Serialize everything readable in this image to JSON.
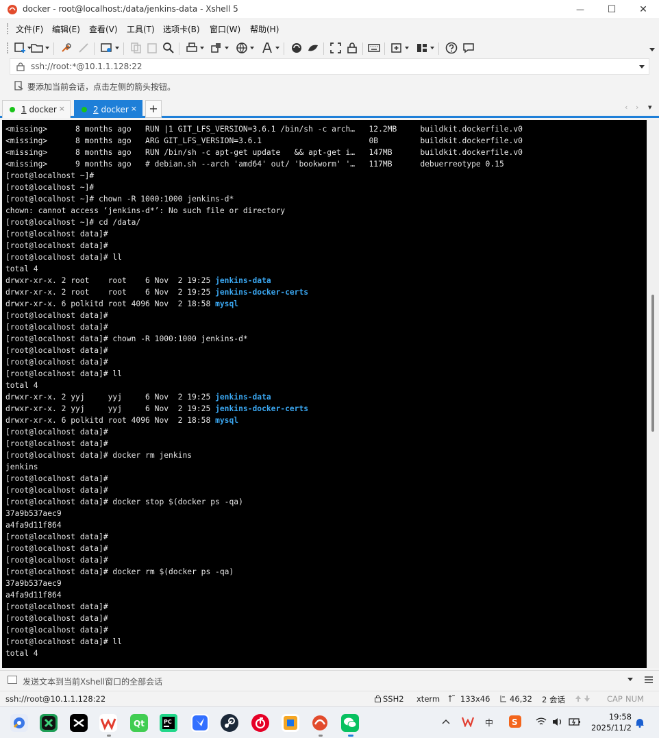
{
  "window": {
    "title": "docker - root@localhost:/data/jenkins-data - Xshell 5",
    "app_icon": "xshell-logo-icon",
    "controls": {
      "minimize": "—",
      "maximize": "☐",
      "close": "✕"
    }
  },
  "menu": {
    "items": [
      "文件(F)",
      "编辑(E)",
      "查看(V)",
      "工具(T)",
      "选项卡(B)",
      "窗口(W)",
      "帮助(H)"
    ]
  },
  "toolbar": {
    "icons": [
      "new-session-icon",
      "open-folder-icon",
      "reconnect-icon",
      "disconnect-icon",
      "properties-icon",
      "copy-icon",
      "paste-icon",
      "find-icon",
      "print-icon",
      "transfer-icon",
      "globe-icon",
      "font-icon",
      "xftp-icon",
      "xmanager-icon",
      "fullscreen-icon",
      "lock-icon",
      "keyboard-icon",
      "add-tab-icon",
      "layout-icon",
      "help-icon",
      "chat-icon"
    ]
  },
  "address": {
    "value": "ssh://root:*@10.1.1.128:22"
  },
  "hint": {
    "text": "要添加当前会话，点击左侧的箭头按钮。"
  },
  "tabs": [
    {
      "index": "1",
      "name": " docker",
      "close": "×",
      "active": false
    },
    {
      "index": "2",
      "name": " docker",
      "close": "×",
      "active": true
    }
  ],
  "tab_add": "+",
  "tab_nav": {
    "prev": "‹",
    "next": "›",
    "menu": "▾"
  },
  "terminal": {
    "lines": [
      {
        "text": "<missing>      8 months ago   RUN |1 GIT_LFS_VERSION=3.6.1 /bin/sh -c arch…   12.2MB     buildkit.dockerfile.v0"
      },
      {
        "text": "<missing>      8 months ago   ARG GIT_LFS_VERSION=3.6.1                       0B         buildkit.dockerfile.v0"
      },
      {
        "text": "<missing>      8 months ago   RUN /bin/sh -c apt-get update   && apt-get i…   147MB      buildkit.dockerfile.v0"
      },
      {
        "text": "<missing>      9 months ago   # debian.sh --arch 'amd64' out/ 'bookworm' '…   117MB      debuerreotype 0.15"
      },
      {
        "text": "[root@localhost ~]#"
      },
      {
        "text": "[root@localhost ~]#"
      },
      {
        "text": "[root@localhost ~]# chown -R 1000:1000 jenkins-d*"
      },
      {
        "text": "chown: cannot access ‘jenkins-d*’: No such file or directory"
      },
      {
        "text": "[root@localhost ~]# cd /data/"
      },
      {
        "text": "[root@localhost data]#"
      },
      {
        "text": "[root@localhost data]#"
      },
      {
        "text": "[root@localhost data]# ll"
      },
      {
        "text": "total 4"
      },
      {
        "text": "drwxr-xr-x. 2 root    root    6 Nov  2 19:25 ",
        "highlight": "jenkins-data"
      },
      {
        "text": "drwxr-xr-x. 2 root    root    6 Nov  2 19:25 ",
        "highlight": "jenkins-docker-certs"
      },
      {
        "text": "drwxr-xr-x. 6 polkitd root 4096 Nov  2 18:58 ",
        "highlight": "mysql"
      },
      {
        "text": "[root@localhost data]#"
      },
      {
        "text": "[root@localhost data]#"
      },
      {
        "text": "[root@localhost data]# chown -R 1000:1000 jenkins-d*"
      },
      {
        "text": "[root@localhost data]#"
      },
      {
        "text": "[root@localhost data]#"
      },
      {
        "text": "[root@localhost data]# ll"
      },
      {
        "text": "total 4"
      },
      {
        "text": "drwxr-xr-x. 2 yyj     yyj     6 Nov  2 19:25 ",
        "highlight": "jenkins-data"
      },
      {
        "text": "drwxr-xr-x. 2 yyj     yyj     6 Nov  2 19:25 ",
        "highlight": "jenkins-docker-certs"
      },
      {
        "text": "drwxr-xr-x. 6 polkitd root 4096 Nov  2 18:58 ",
        "highlight": "mysql"
      },
      {
        "text": "[root@localhost data]#"
      },
      {
        "text": "[root@localhost data]#"
      },
      {
        "text": "[root@localhost data]# docker rm jenkins"
      },
      {
        "text": "jenkins"
      },
      {
        "text": "[root@localhost data]#"
      },
      {
        "text": "[root@localhost data]#"
      },
      {
        "text": "[root@localhost data]# docker stop $(docker ps -qa)"
      },
      {
        "text": "37a9b537aec9"
      },
      {
        "text": "a4fa9d11f864"
      },
      {
        "text": "[root@localhost data]#"
      },
      {
        "text": "[root@localhost data]#"
      },
      {
        "text": "[root@localhost data]#"
      },
      {
        "text": "[root@localhost data]# docker rm $(docker ps -qa)"
      },
      {
        "text": "37a9b537aec9"
      },
      {
        "text": "a4fa9d11f864"
      },
      {
        "text": "[root@localhost data]#"
      },
      {
        "text": "[root@localhost data]#"
      },
      {
        "text": "[root@localhost data]#"
      },
      {
        "text": "[root@localhost data]# ll"
      },
      {
        "text": "total 4"
      }
    ]
  },
  "compose": {
    "placeholder": "发送文本到当前Xshell窗口的全部会话"
  },
  "status": {
    "address": "ssh://root@10.1.1.128:22",
    "protocol": "SSH2",
    "term": "xterm",
    "size": "133x46",
    "cursor": "46,32",
    "sessions": "2 会话",
    "caps": "CAP",
    "num": "NUM"
  },
  "taskbar": {
    "apps": [
      "settings-app-icon",
      "xmind-app-icon",
      "capcut-app-icon",
      "wps-app-icon",
      "qt-app-icon",
      "pycharm-app-icon",
      "feishu-app-icon",
      "steam-app-icon",
      "netease-music-app-icon",
      "screenshot-app-icon",
      "xshell-app-icon",
      "wechat-app-icon"
    ],
    "tray_ime": "中",
    "time": "19:58",
    "date": "2025/11/2"
  },
  "colors": {
    "accent": "#1e7fd8",
    "terminal_bg": "#000000",
    "dir_highlight": "#3aa6f0",
    "session_dot": "#19c319"
  }
}
